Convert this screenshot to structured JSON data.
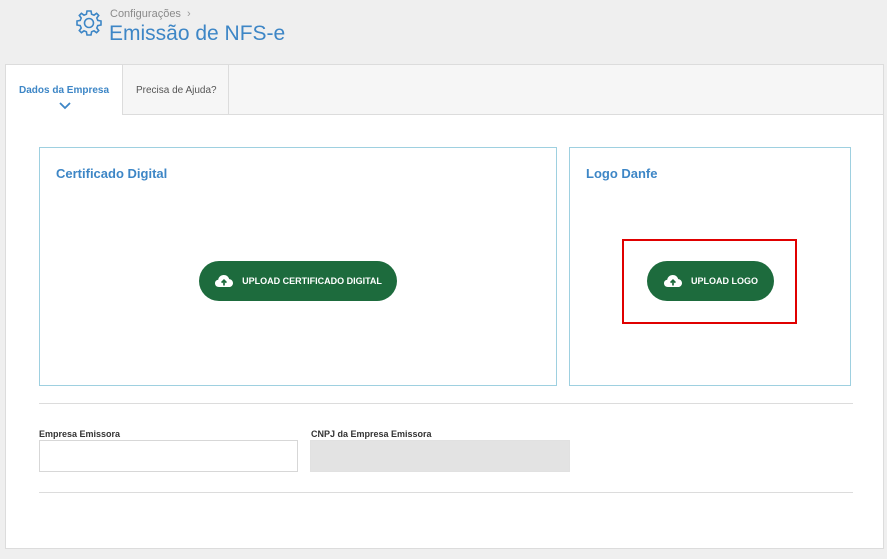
{
  "header": {
    "breadcrumb": "Configurações",
    "title": "Emissão de NFS-e"
  },
  "tabs": [
    {
      "label": "Dados da Empresa"
    },
    {
      "label": "Precisa de Ajuda?"
    }
  ],
  "certificado": {
    "title": "Certificado Digital",
    "button": "UPLOAD CERTIFICADO DIGITAL"
  },
  "logo": {
    "title": "Logo Danfe",
    "button": "UPLOAD LOGO"
  },
  "fields": {
    "empresa_label": "Empresa Emissora",
    "empresa_value": "",
    "cnpj_label": "CNPJ da Empresa Emissora",
    "cnpj_value": ""
  },
  "colors": {
    "accent": "#3d86c6",
    "button": "#1d6b3d",
    "highlight": "#e00000"
  }
}
